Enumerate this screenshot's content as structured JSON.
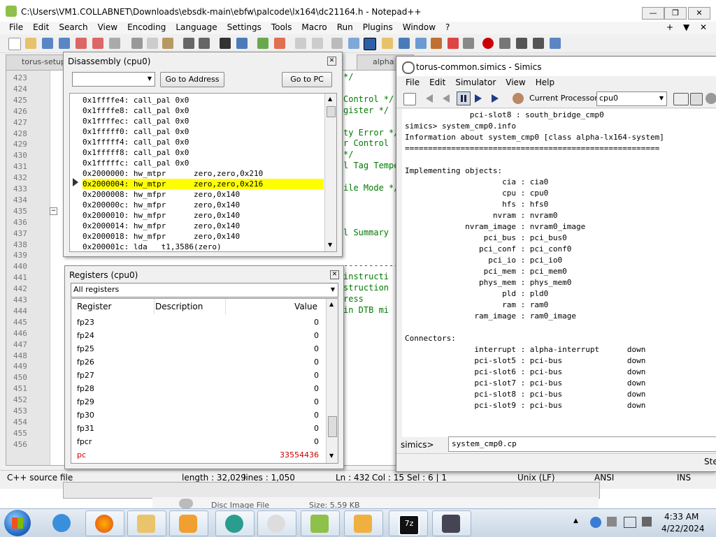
{
  "npp": {
    "title": "C:\\Users\\VM1.COLLABNET\\Downloads\\ebsdk-main\\ebfw\\palcode\\lx164\\dc21164.h - Notepad++",
    "menu": [
      "File",
      "Edit",
      "Search",
      "View",
      "Encoding",
      "Language",
      "Settings",
      "Tools",
      "Macro",
      "Run",
      "Plugins",
      "Window",
      "?"
    ],
    "right_controls": [
      "+",
      "▼",
      "✕"
    ],
    "tabs": [
      "torus-setup",
      "alpha"
    ],
    "line_numbers": [
      "423",
      "424",
      "425",
      "426",
      "427",
      "428",
      "429",
      "430",
      "431",
      "432",
      "433",
      "434",
      "435",
      "436",
      "437",
      "438",
      "439",
      "440",
      "441",
      "442",
      "443",
      "444",
      "445",
      "446",
      "447",
      "448",
      "449",
      "450",
      "451",
      "452",
      "453",
      "454",
      "455",
      "456"
    ],
    "visible_code": [
      {
        "line": "423",
        "text": "*/"
      },
      {
        "line": "425",
        "text": "Control */"
      },
      {
        "line": "426",
        "text": "gister */"
      },
      {
        "line": "428",
        "text": "ty Error */"
      },
      {
        "line": "429",
        "text": "r Control"
      },
      {
        "line": "430",
        "text": "*/"
      },
      {
        "line": "431",
        "text": "l Tag Tempe"
      },
      {
        "line": "433",
        "text": "ile Mode */"
      },
      {
        "line": "437",
        "text": "l Summary"
      },
      {
        "line": "440",
        "text": "------------"
      },
      {
        "line": "441",
        "text": "instructi"
      },
      {
        "line": "442",
        "text": "struction"
      },
      {
        "line": "443",
        "text": "ress"
      },
      {
        "line": "444",
        "text": "in DTB mi"
      }
    ],
    "status": {
      "type": "C++ source file",
      "length": "length : 32,029",
      "lines": "lines : 1,050",
      "ln": "Ln : 432",
      "col": "Col : 15",
      "sel": "Sel : 6 | 1",
      "eol": "Unix (LF)",
      "encoding": "ANSI",
      "mode": "INS"
    }
  },
  "disassembly": {
    "title": "Disassembly (cpu0)",
    "goto_address": "Go to Address",
    "goto_pc": "Go to PC",
    "rows": [
      "0x1ffffe4: call_pal 0x0",
      "0x1ffffe8: call_pal 0x0",
      "0x1ffffec: call_pal 0x0",
      "0x1fffff0: call_pal 0x0",
      "0x1fffff4: call_pal 0x0",
      "0x1fffff8: call_pal 0x0",
      "0x1fffffc: call_pal 0x0",
      "0x2000000: hw_mtpr      zero,zero,0x210",
      "0x2000004: hw_mtpr      zero,zero,0x216",
      "0x2000008: hw_mfpr      zero,0x140",
      "0x200000c: hw_mfpr      zero,0x140",
      "0x2000010: hw_mfpr      zero,0x140",
      "0x2000014: hw_mfpr      zero,0x140",
      "0x2000018: hw_mfpr      zero,0x140",
      "0x200001c: lda   t1,3586(zero)"
    ],
    "highlight_index": 8
  },
  "registers": {
    "title": "Registers (cpu0)",
    "filter": "All registers",
    "headers": [
      "Register",
      "Description",
      "Value"
    ],
    "rows": [
      {
        "name": "fp23",
        "value": "0"
      },
      {
        "name": "fp24",
        "value": "0"
      },
      {
        "name": "fp25",
        "value": "0"
      },
      {
        "name": "fp26",
        "value": "0"
      },
      {
        "name": "fp27",
        "value": "0"
      },
      {
        "name": "fp28",
        "value": "0"
      },
      {
        "name": "fp29",
        "value": "0"
      },
      {
        "name": "fp30",
        "value": "0"
      },
      {
        "name": "fp31",
        "value": "0"
      },
      {
        "name": "fpcr",
        "value": "0"
      },
      {
        "name": "pc",
        "value": "33554436"
      }
    ],
    "changed_color": "#cc0000"
  },
  "simics": {
    "title": "torus-common.simics - Simics",
    "menu": [
      "File",
      "Edit",
      "Simulator",
      "View",
      "Help"
    ],
    "processor_label": "Current Processor:",
    "processor_value": "cpu0",
    "console_lines": [
      "              pci-slot8 : south_bridge_cmp0",
      "simics> system_cmp0.info",
      "Information about system_cmp0 [class alpha-lx164-system]",
      "=======================================================",
      "",
      "Implementing objects:",
      "                     cia : cia0",
      "                     cpu : cpu0",
      "                     hfs : hfs0",
      "                   nvram : nvram0",
      "             nvram_image : nvram0_image",
      "                 pci_bus : pci_bus0",
      "                pci_conf : pci_conf0",
      "                  pci_io : pci_io0",
      "                 pci_mem : pci_mem0",
      "                phys_mem : phys_mem0",
      "                     pld : pld0",
      "                     ram : ram0",
      "               ram_image : ram0_image",
      "",
      "Connectors:",
      "               interrupt : alpha-interrupt      down",
      "               pci-slot5 : pci-bus              down",
      "               pci-slot6 : pci-bus              down",
      "               pci-slot7 : pci-bus              down",
      "               pci-slot8 : pci-bus              down",
      "               pci-slot9 : pci-bus              down"
    ],
    "prompt": "simics>",
    "input_value": "system_cmp0.cp",
    "status_right": "Ste"
  },
  "background": {
    "file_label": "Disc Image File",
    "size_label": "Size: 5.59 KB"
  },
  "taskbar": {
    "time": "4:33 AM",
    "date": "4/22/2024",
    "apps": [
      "ie-icon",
      "firefox-icon",
      "explorer-icon",
      "media-player-icon",
      "app-icon",
      "bird-icon",
      "notepadpp-icon",
      "hxd-icon",
      "7zip-icon",
      "remote-desktop-icon"
    ]
  },
  "colors": {
    "highlight": "#ffff00",
    "code_green": "#007a00",
    "start_orb": "#2a6fc9"
  }
}
